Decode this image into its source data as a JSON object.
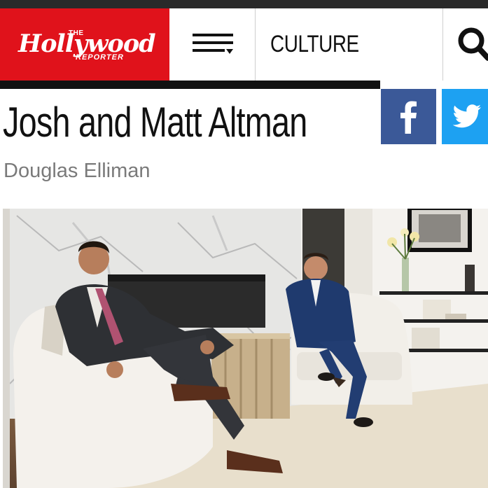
{
  "header": {
    "logo": {
      "the": "THE",
      "main": "Hollywood",
      "reporter": "REPORTER"
    },
    "menu_icon": "menu-icon",
    "section": "CULTURE",
    "search_icon": "search-icon",
    "brand_color": "#e0121b"
  },
  "article": {
    "title": "Josh and Matt Altman",
    "subtitle": "Douglas Elliman"
  },
  "share": {
    "facebook_icon": "facebook-icon",
    "facebook_color": "#3b5998",
    "twitter_icon": "twitter-icon",
    "twitter_color": "#1da1f2"
  },
  "photo": {
    "subject": "two men in suits seated in white armchairs in a living room"
  }
}
